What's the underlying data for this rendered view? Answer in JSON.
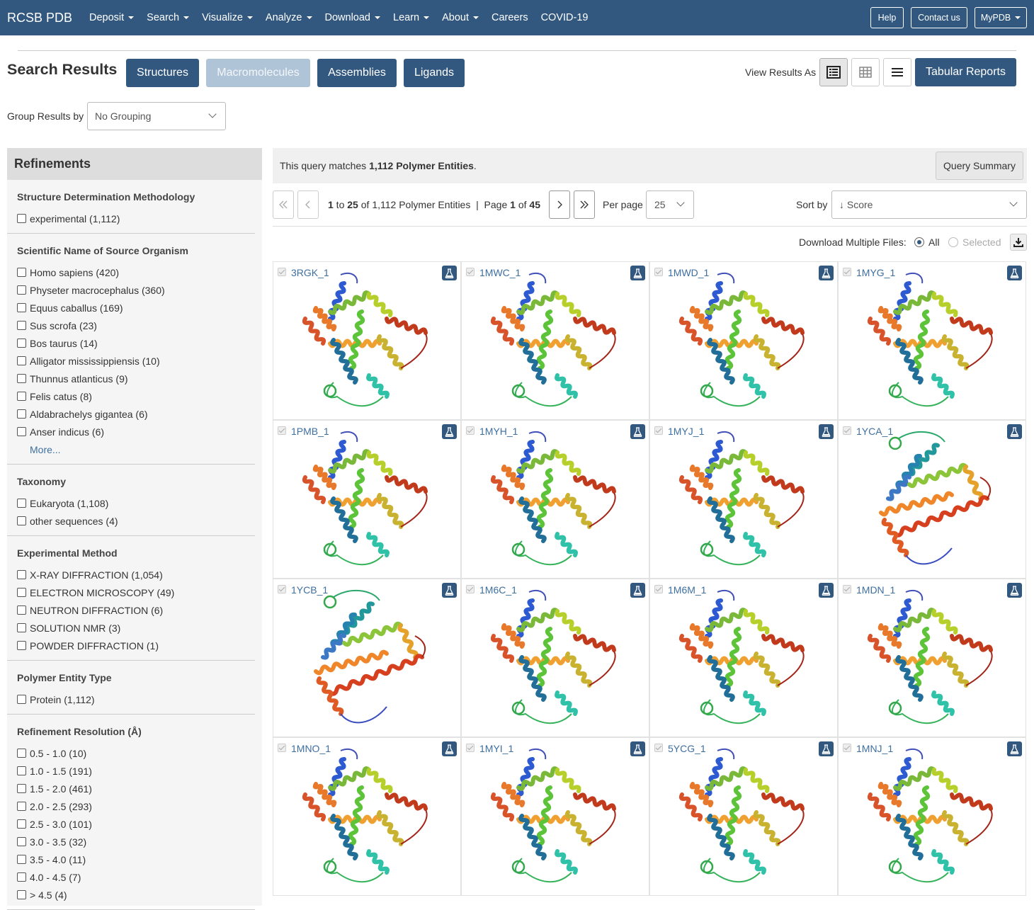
{
  "navbar": {
    "brand": "RCSB PDB",
    "menu": [
      {
        "label": "Deposit",
        "caret": true
      },
      {
        "label": "Search",
        "caret": true
      },
      {
        "label": "Visualize",
        "caret": true
      },
      {
        "label": "Analyze",
        "caret": true
      },
      {
        "label": "Download",
        "caret": true
      },
      {
        "label": "Learn",
        "caret": true
      },
      {
        "label": "About",
        "caret": true
      },
      {
        "label": "Careers",
        "caret": false
      },
      {
        "label": "COVID-19",
        "caret": false
      }
    ],
    "help": "Help",
    "contact": "Contact us",
    "mypdb": "MyPDB"
  },
  "header": {
    "title": "Search Results",
    "tabs": [
      "Structures",
      "Macromolecules",
      "Assemblies",
      "Ligands"
    ],
    "active_tab": "Macromolecules",
    "view_as_label": "View Results As",
    "tabular_reports": "Tabular Reports"
  },
  "grouping": {
    "label": "Group Results by",
    "value": "No Grouping"
  },
  "sidebar": {
    "title": "Refinements",
    "facets": [
      {
        "title": "Structure Determination Methodology",
        "options": [
          "experimental (1,112)"
        ],
        "more": ""
      },
      {
        "title": "Scientific Name of Source Organism",
        "options": [
          "Homo sapiens (420)",
          "Physeter macrocephalus (360)",
          "Equus caballus (169)",
          "Sus scrofa (23)",
          "Bos taurus (14)",
          "Alligator mississippiensis (10)",
          "Thunnus atlanticus (9)",
          "Felis catus (8)",
          "Aldabrachelys gigantea (6)",
          "Anser indicus (6)"
        ],
        "more": "More..."
      },
      {
        "title": "Taxonomy",
        "options": [
          "Eukaryota (1,108)",
          "other sequences (4)"
        ],
        "more": ""
      },
      {
        "title": "Experimental Method",
        "options": [
          "X-RAY DIFFRACTION (1,054)",
          "ELECTRON MICROSCOPY (49)",
          "NEUTRON DIFFRACTION (6)",
          "SOLUTION NMR (3)",
          "POWDER DIFFRACTION (1)"
        ],
        "more": ""
      },
      {
        "title": "Polymer Entity Type",
        "options": [
          "Protein (1,112)"
        ],
        "more": ""
      },
      {
        "title": "Refinement Resolution (Å)",
        "options": [
          "0.5 - 1.0 (10)",
          "1.0 - 1.5 (191)",
          "1.5 - 2.0 (461)",
          "2.0 - 2.5 (293)",
          "2.5 - 3.0 (101)",
          "3.0 - 3.5 (32)",
          "3.5 - 4.0 (11)",
          "4.0 - 4.5 (7)",
          "> 4.5 (4)"
        ],
        "more": ""
      }
    ]
  },
  "summary": {
    "prefix": "This query matches ",
    "count": "1,112 Polymer Entities",
    "suffix": ".",
    "query_summary": "Query Summary"
  },
  "pager": {
    "range_start": "1",
    "to": " to ",
    "range_end": "25",
    "of": " of ",
    "total": "1,112 Polymer Entities",
    "sep": "  |  ",
    "page_label": "Page ",
    "page": "1",
    "page_of": " of ",
    "pages": "45",
    "per_page_label": "Per page",
    "per_page": "25",
    "sort_label": "Sort by",
    "sort_value": "↓ Score"
  },
  "download": {
    "label": "Download Multiple Files:",
    "all": "All",
    "selected": "Selected",
    "mode": "All"
  },
  "results": [
    {
      "id": "3RGK_1",
      "style": "a"
    },
    {
      "id": "1MWC_1",
      "style": "a"
    },
    {
      "id": "1MWD_1",
      "style": "a"
    },
    {
      "id": "1MYG_1",
      "style": "a"
    },
    {
      "id": "1PMB_1",
      "style": "a"
    },
    {
      "id": "1MYH_1",
      "style": "a"
    },
    {
      "id": "1MYJ_1",
      "style": "a"
    },
    {
      "id": "1YCA_1",
      "style": "b"
    },
    {
      "id": "1YCB_1",
      "style": "b"
    },
    {
      "id": "1M6C_1",
      "style": "a"
    },
    {
      "id": "1M6M_1",
      "style": "a"
    },
    {
      "id": "1MDN_1",
      "style": "a"
    },
    {
      "id": "1MNO_1",
      "style": "a"
    },
    {
      "id": "1MYI_1",
      "style": "a"
    },
    {
      "id": "5YCG_1",
      "style": "a"
    },
    {
      "id": "1MNJ_1",
      "style": "a"
    }
  ],
  "icons": {
    "result_badge": "flask-icon",
    "download": "download-icon",
    "view_list": "list-view-icon",
    "view_grid": "grid-view-icon",
    "view_compact": "compact-list-icon"
  },
  "colors": {
    "brand": "#325880",
    "link": "#3e6fa1"
  }
}
